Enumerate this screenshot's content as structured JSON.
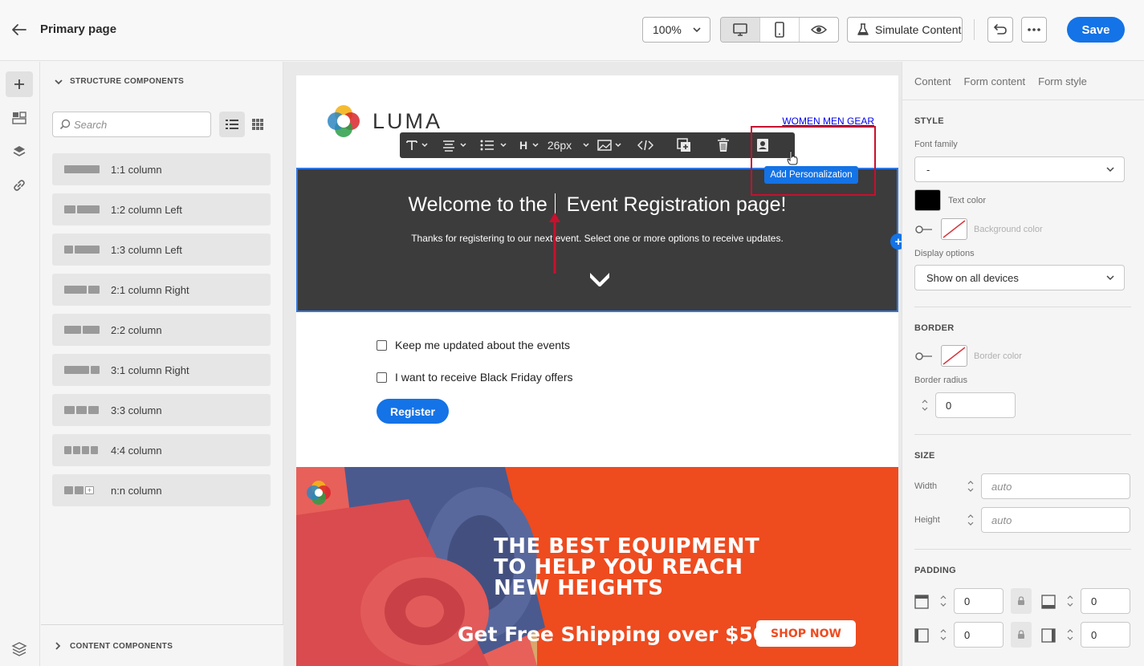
{
  "header": {
    "title": "Primary page",
    "zoom": "100%",
    "simulate_label": "Simulate Content",
    "save_label": "Save"
  },
  "structure_panel": {
    "heading": "STRUCTURE COMPONENTS",
    "search_placeholder": "Search",
    "items": [
      {
        "label": "1:1 column"
      },
      {
        "label": "1:2 column Left"
      },
      {
        "label": "1:3 column Left"
      },
      {
        "label": "2:1 column Right"
      },
      {
        "label": "2:2 column"
      },
      {
        "label": "3:1 column Right"
      },
      {
        "label": "3:3 column"
      },
      {
        "label": "4:4 column"
      },
      {
        "label": "n:n column"
      }
    ],
    "content_heading": "CONTENT COMPONENTS"
  },
  "email": {
    "logo_text": "LUMA",
    "nav_text": "WOMEN MEN GEAR",
    "hero_title_part1": "Welcome to the",
    "hero_title_part2": "Event Registration page!",
    "hero_subtitle": "Thanks for registering to our next event. Select one or more options to receive updates.",
    "option_1": "Keep me updated about the events",
    "option_2": "I want to receive Black Friday offers",
    "register_label": "Register",
    "banner_line_1": "THE BEST EQUIPMENT",
    "banner_line_2": "TO HELP YOU REACH",
    "banner_line_3": "NEW HEIGHTS",
    "shipping_text": "Get Free Shipping over $50",
    "shop_label": "SHOP NOW"
  },
  "toolbar": {
    "heading_label": "H",
    "font_size": "26px",
    "tooltip": "Add Personalization"
  },
  "right_panel": {
    "tabs": [
      "Content",
      "Form content",
      "Form style"
    ],
    "style_heading": "STYLE",
    "font_family_label": "Font family",
    "font_family_value": "-",
    "text_color_label": "Text color",
    "text_color": "#000000",
    "background_color_label": "Background color",
    "display_options_label": "Display options",
    "display_options_value": "Show on all devices",
    "border_heading": "BORDER",
    "border_color_label": "Border color",
    "border_radius_label": "Border radius",
    "border_radius_value": "0",
    "size_heading": "SIZE",
    "width_label": "Width",
    "width_placeholder": "auto",
    "height_label": "Height",
    "height_placeholder": "auto",
    "padding_heading": "PADDING",
    "padding_top": "0",
    "padding_bottom": "0",
    "padding_left": "0",
    "padding_right": "0"
  },
  "colors": {
    "accent": "#1473e6",
    "annotation_red": "#c8102e",
    "hero_bg": "#3c3c3c",
    "banner_orange": "#ee4b1f"
  }
}
